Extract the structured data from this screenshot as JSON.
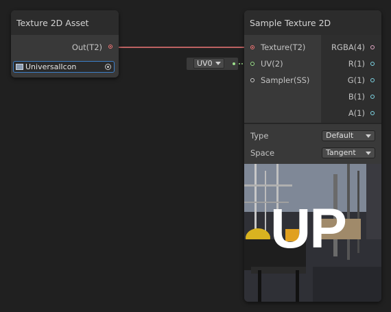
{
  "texture_asset_node": {
    "title": "Texture 2D Asset",
    "output_label": "Out(T2)",
    "asset_field": {
      "icon": "texture-icon",
      "value": "UniversalIcon",
      "picker_icon": "object-picker-icon"
    }
  },
  "uv_node": {
    "selected": "UV0"
  },
  "sample_texture_node": {
    "title": "Sample Texture 2D",
    "inputs": [
      {
        "label": "Texture(T2)",
        "color": "#f07878"
      },
      {
        "label": "UV(2)",
        "color": "#9ee28c"
      },
      {
        "label": "Sampler(SS)",
        "color": "#d0d0d0"
      }
    ],
    "outputs": [
      {
        "label": "RGBA(4)",
        "color": "#e6a8c8"
      },
      {
        "label": "R(1)",
        "color": "#7fd8e8"
      },
      {
        "label": "G(1)",
        "color": "#7fd8e8"
      },
      {
        "label": "B(1)",
        "color": "#7fd8e8"
      },
      {
        "label": "A(1)",
        "color": "#7fd8e8"
      }
    ],
    "settings": [
      {
        "label": "Type",
        "value": "Default"
      },
      {
        "label": "Space",
        "value": "Tangent"
      }
    ],
    "preview_text": "UP"
  },
  "colors": {
    "background": "#202020",
    "node_body": "#393939",
    "node_header": "#2c2c2c",
    "texture_edge": "#f07878",
    "uv_edge": "#9ee28c",
    "selected_field_border": "#3d7fc8"
  }
}
